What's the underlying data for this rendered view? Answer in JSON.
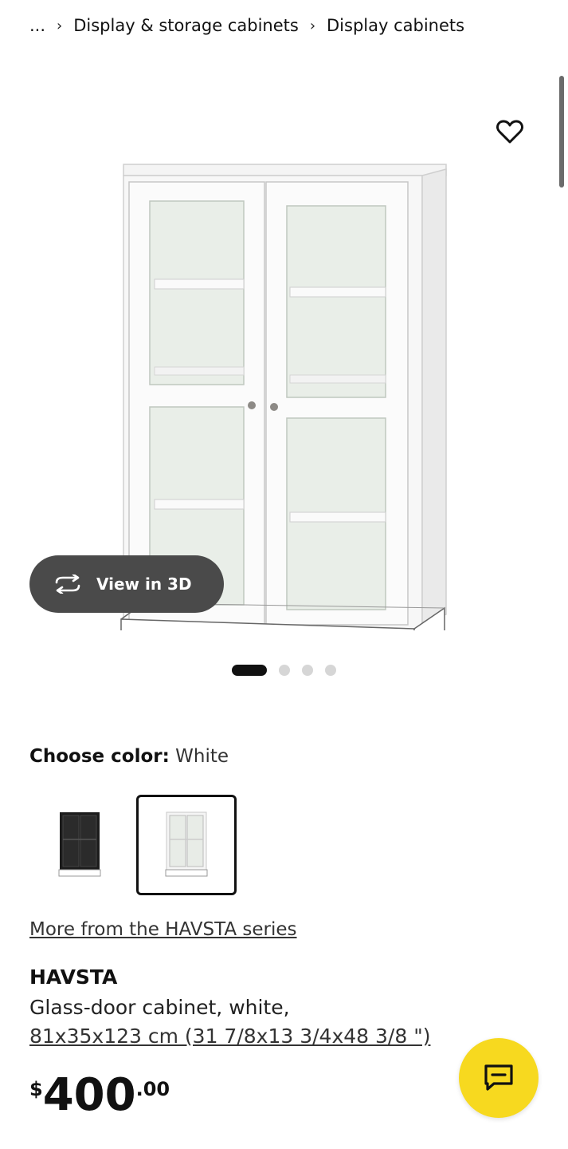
{
  "breadcrumb": {
    "ellipsis": "...",
    "items": [
      "Display & storage cabinets",
      "Display cabinets"
    ]
  },
  "gallery": {
    "view_3d_label": "View in 3D",
    "dots_total": 4,
    "active_dot": 1,
    "favorite_icon": "heart-outline-icon"
  },
  "color": {
    "label": "Choose color:",
    "selected": "White",
    "options": [
      "black",
      "white"
    ]
  },
  "series_link": "More from the HAVSTA series",
  "product": {
    "name": "HAVSTA",
    "description": "Glass-door cabinet, white,",
    "dimensions": "81x35x123 cm (31 7/8x13 3/4x48 3/8 \")",
    "price_currency": "$",
    "price_integer": "400",
    "price_decimal": ".00"
  },
  "chat_button": {
    "icon": "chat-bubble-icon",
    "color": "#f7d91f"
  },
  "colors": {
    "view3d_bg": "#4a4a4a",
    "dot_active": "#111111",
    "dot_inactive": "#d6d6d6"
  }
}
